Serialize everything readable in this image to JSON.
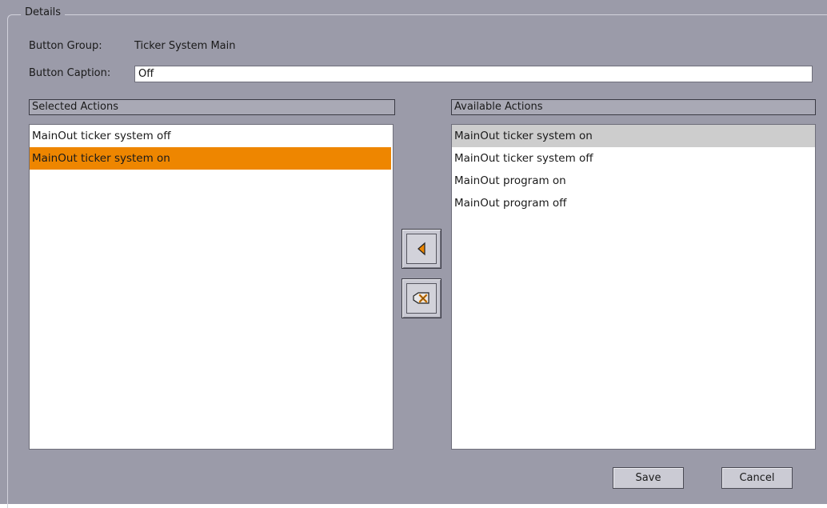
{
  "details": {
    "title": "Details",
    "button_group_label": "Button Group:",
    "button_group_value": "Ticker System Main",
    "button_caption_label": "Button Caption:",
    "button_caption_value": "Off"
  },
  "selected_actions": {
    "header": "Selected Actions",
    "items": [
      {
        "label": "MainOut ticker system off",
        "state": "normal"
      },
      {
        "label": "MainOut ticker system on",
        "state": "selected"
      }
    ]
  },
  "available_actions": {
    "header": "Available Actions",
    "items": [
      {
        "label": "MainOut ticker system on",
        "state": "hover"
      },
      {
        "label": "MainOut ticker system off",
        "state": "normal"
      },
      {
        "label": "MainOut program on",
        "state": "normal"
      },
      {
        "label": "MainOut program off",
        "state": "normal"
      }
    ]
  },
  "tools": {
    "add_icon": "left-arrow-icon",
    "remove_icon": "remove-icon"
  },
  "buttons": {
    "save": "Save",
    "cancel": "Cancel"
  },
  "colors": {
    "background": "#9b9ba9",
    "selection": "#ee8600",
    "hover": "#cdcdcd",
    "arrow": "#ee8600"
  }
}
